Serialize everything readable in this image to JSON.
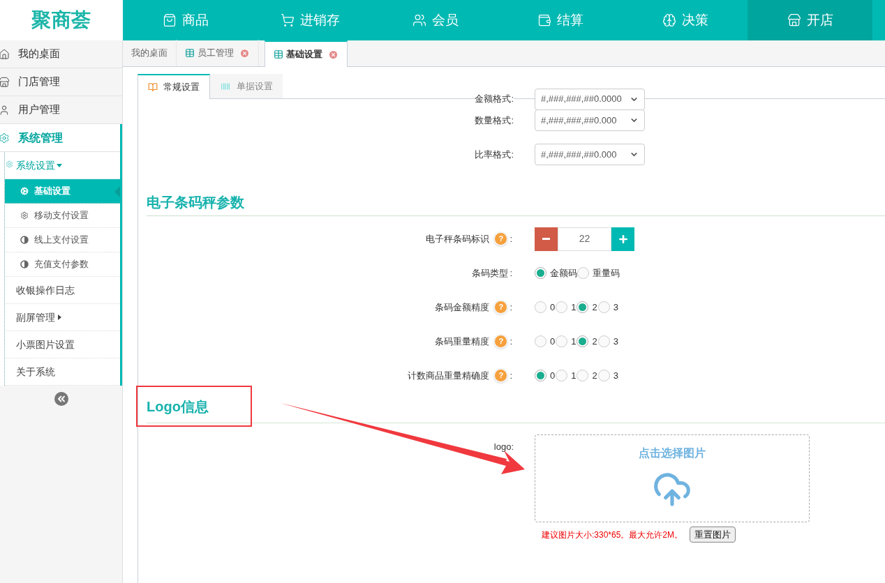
{
  "brand": "聚商荟",
  "nav": [
    {
      "label": "商品",
      "selected": false
    },
    {
      "label": "进销存",
      "selected": false
    },
    {
      "label": "会员",
      "selected": false
    },
    {
      "label": "结算",
      "selected": false
    },
    {
      "label": "决策",
      "selected": false
    },
    {
      "label": "开店",
      "selected": true
    }
  ],
  "sidebar": [
    {
      "label": "我的桌面",
      "selected": false
    },
    {
      "label": "门店管理",
      "selected": false
    },
    {
      "label": "用户管理",
      "selected": false
    },
    {
      "label": "系统管理",
      "selected": true,
      "children": [
        {
          "label": "系统设置",
          "expanded": true,
          "children": [
            {
              "label": "基础设置",
              "selected": true
            },
            {
              "label": "移动支付设置",
              "selected": false
            },
            {
              "label": "线上支付设置",
              "selected": false
            },
            {
              "label": "充值支付参数",
              "selected": false
            }
          ]
        },
        {
          "label": "收银操作日志"
        },
        {
          "label": "副屏管理",
          "expanded": false
        },
        {
          "label": "小票图片设置"
        },
        {
          "label": "关于系统"
        }
      ]
    }
  ],
  "page_tabs": [
    {
      "label": "我的桌面",
      "selected": false,
      "closable": false
    },
    {
      "label": "员工管理",
      "selected": false,
      "closable": true
    },
    {
      "label": "基础设置",
      "selected": true,
      "closable": true
    }
  ],
  "inner_tabs": [
    {
      "label": "常规设置",
      "selected": true
    },
    {
      "label": "单据设置",
      "selected": false
    }
  ],
  "format_rows": [
    {
      "label": "金额格式:",
      "value": "#,###,###,##0.0000"
    },
    {
      "label": "数量格式:",
      "value": "#,###,###,##0.000"
    },
    {
      "label": "比率格式:",
      "value": "#,###,###,##0.000"
    }
  ],
  "scale_section": {
    "title": "电子条码秤参数",
    "rows": [
      {
        "kind": "stepper",
        "label": "电子秤条码标识",
        "help": "?",
        "colon": ":",
        "value": "22"
      },
      {
        "kind": "radio",
        "label": "条码类型",
        "colon": ":",
        "options": [
          {
            "label": "金额码",
            "selected": true
          },
          {
            "label": "重量码",
            "selected": false
          }
        ]
      },
      {
        "kind": "radio",
        "label": "条码金额精度",
        "help": "?",
        "colon": ":",
        "options": [
          {
            "label": "0",
            "selected": false
          },
          {
            "label": "1",
            "selected": false
          },
          {
            "label": "2",
            "selected": true
          },
          {
            "label": "3",
            "selected": false
          }
        ]
      },
      {
        "kind": "radio",
        "label": "条码重量精度",
        "help": "?",
        "colon": ":",
        "options": [
          {
            "label": "0",
            "selected": false
          },
          {
            "label": "1",
            "selected": false
          },
          {
            "label": "2",
            "selected": true
          },
          {
            "label": "3",
            "selected": false
          }
        ]
      },
      {
        "kind": "radio",
        "label": "计数商品重量精确度",
        "help": "?",
        "colon": ":",
        "options": [
          {
            "label": "0",
            "selected": true
          },
          {
            "label": "1",
            "selected": false
          },
          {
            "label": "2",
            "selected": false
          },
          {
            "label": "3",
            "selected": false
          }
        ]
      }
    ]
  },
  "logo_section": {
    "title": "Logo信息",
    "field_label": "logo:",
    "upload_prompt": "点击选择图片",
    "hint": "建议图片大小:330*65。最大允许2M。",
    "reset_button": "重置图片"
  }
}
